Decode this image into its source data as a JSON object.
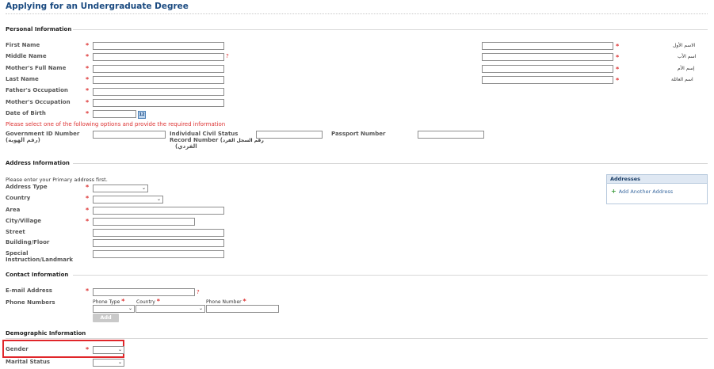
{
  "page": {
    "title": "Applying for an Undergraduate Degree"
  },
  "personal": {
    "heading": "Personal Information",
    "first_name": "First Name",
    "middle_name": "Middle Name",
    "mother_full_name": "Mother's Full Name",
    "last_name": "Last Name",
    "father_occupation": "Father's Occupation",
    "mother_occupation": "Mother's Occupation",
    "dob": "Date of Birth",
    "ar_first": "الاسم الأول",
    "ar_father": "اسم الأب",
    "ar_mother": "إسم الأم",
    "ar_family": "اسم العائلة",
    "instruction": "Please select one of the following options and provide the required information",
    "gov_id_line1": "Government ID Number",
    "gov_id_line2": "(رقم الهوية)",
    "civil_line1": "Individual Civil Status",
    "civil_line2a": "Record Number (",
    "civil_line2b": "رقم السجل الفرد",
    "civil_line3": "(الفردي",
    "passport": "Passport Number",
    "calendar_glyph": "12",
    "required": "*",
    "help": "?"
  },
  "address": {
    "heading": "Address Information",
    "note": "Please enter your Primary address first.",
    "type": "Address Type",
    "country": "Country",
    "area": "Area",
    "city": "City/Village",
    "street": "Street",
    "building": "Building/Floor",
    "special1": "Special",
    "special2": "Instruction/Landmark",
    "box_title": "Addresses",
    "add_link": "Add Another Address",
    "plus": "+"
  },
  "contact": {
    "heading": "Contact Information",
    "email": "E-mail Address",
    "phones": "Phone Numbers",
    "phone_type": "Phone Type",
    "country": "Country",
    "phone_number": "Phone Number",
    "add_more": "Add More"
  },
  "demographic": {
    "heading": "Demographic Information",
    "gender": "Gender",
    "marital": "Marital Status"
  },
  "icons": {
    "dropdown": "chevron-down-icon",
    "calendar": "calendar-icon",
    "add": "plus-icon"
  },
  "colors": {
    "title": "#1a4a80",
    "required": "#d33333",
    "highlight": "#e0262a"
  }
}
